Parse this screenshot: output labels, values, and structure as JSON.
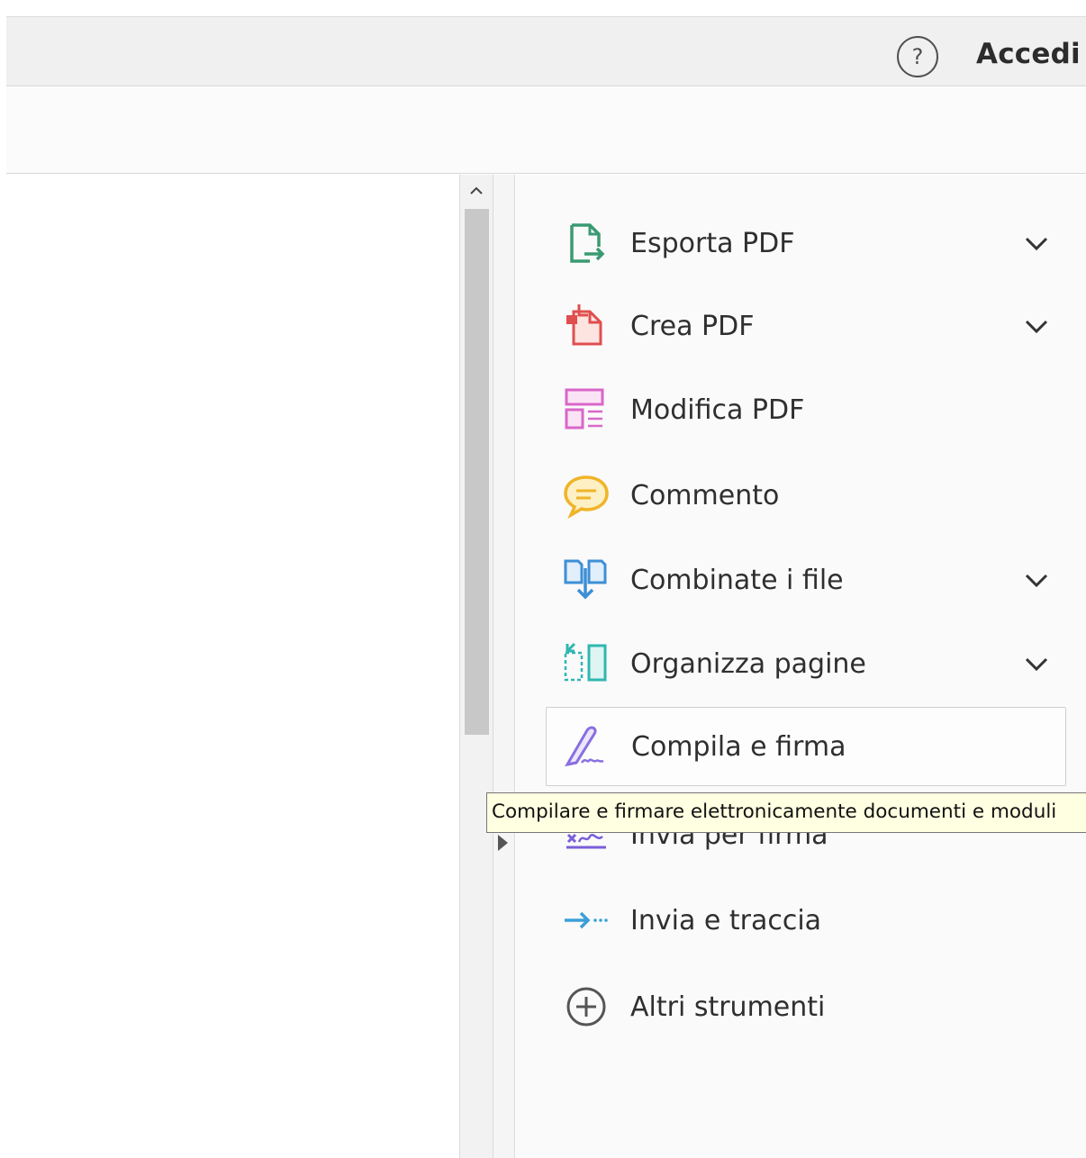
{
  "header": {
    "help_symbol": "?",
    "signin_label": "Accedi"
  },
  "tools": [
    {
      "label": "Esporta PDF",
      "icon": "export-pdf-icon",
      "color": "#3a9a72",
      "expandable": true
    },
    {
      "label": "Crea PDF",
      "icon": "create-pdf-icon",
      "color": "#e04f4f",
      "expandable": true
    },
    {
      "label": "Modifica PDF",
      "icon": "edit-pdf-icon",
      "color": "#d967c9",
      "expandable": false
    },
    {
      "label": "Commento",
      "icon": "comment-icon",
      "color": "#f0b429",
      "expandable": false
    },
    {
      "label": "Combinate i file",
      "icon": "combine-files-icon",
      "color": "#3d8fd6",
      "expandable": true
    },
    {
      "label": "Organizza pagine",
      "icon": "organize-pages-icon",
      "color": "#2fb7b0",
      "expandable": true
    },
    {
      "label": "Compila e firma",
      "icon": "fill-sign-icon",
      "color": "#8a6fe0",
      "expandable": false,
      "active": true
    },
    {
      "label": "Invia per firma",
      "icon": "send-for-signature-icon",
      "color": "#7a5fd9",
      "expandable": false
    },
    {
      "label": "Invia e traccia",
      "icon": "send-track-icon",
      "color": "#3ca0d8",
      "expandable": false
    },
    {
      "label": "Altri strumenti",
      "icon": "more-tools-icon",
      "color": "#555555",
      "expandable": false
    }
  ],
  "tooltip": {
    "text": "Compilare e firmare elettronicamente documenti e moduli"
  }
}
